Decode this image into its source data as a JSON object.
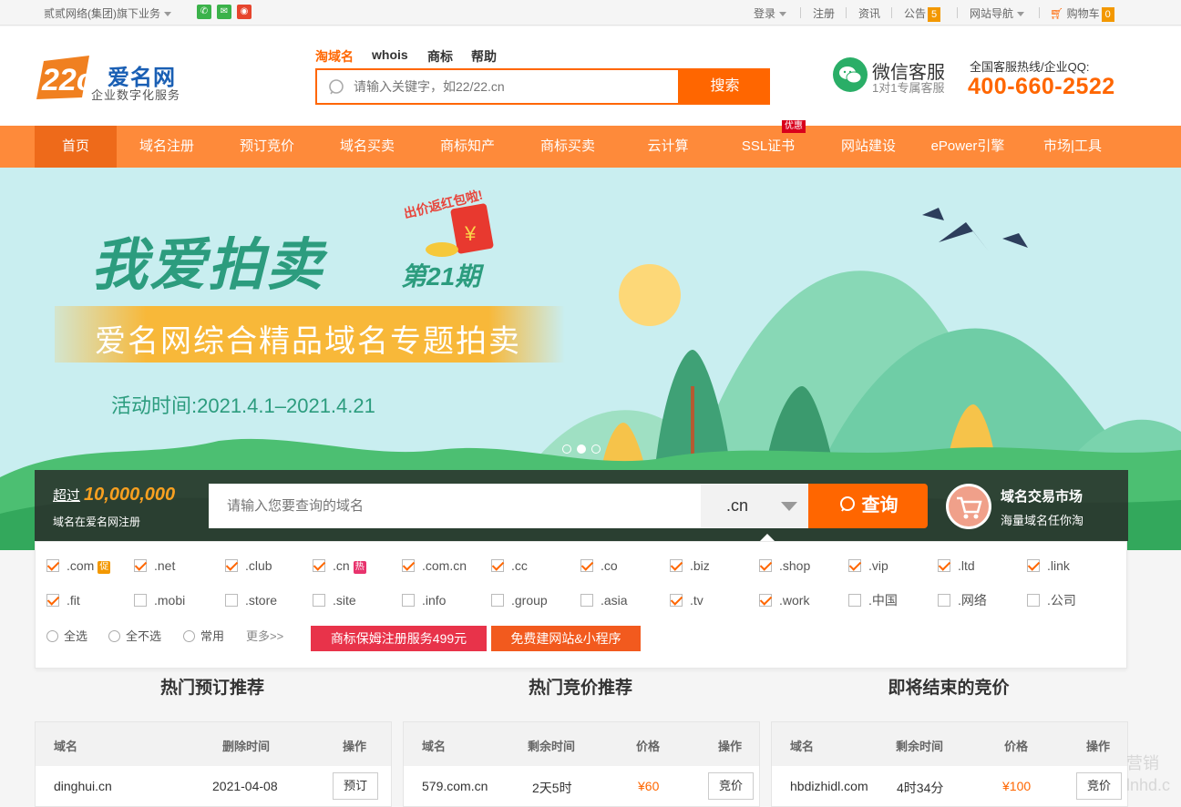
{
  "topbar": {
    "group_link": "贰贰网络(集团)旗下业务",
    "social": [
      {
        "icon": "app-icon",
        "color": "#3bb24a"
      },
      {
        "icon": "wechat-icon",
        "color": "#3bb24a"
      },
      {
        "icon": "weibo-icon",
        "color": "#e6452d"
      }
    ],
    "login": "登录",
    "register": "注册",
    "news": "资讯",
    "notice": "公告",
    "notice_count": "5",
    "site_nav": "网站导航",
    "cart": "购物车",
    "cart_count": "0"
  },
  "header": {
    "logo_mark": "22cn",
    "logo_name": "爱名网",
    "logo_slogan": "企业数字化服务",
    "search_tabs": [
      "淘域名",
      "whois",
      "商标",
      "帮助"
    ],
    "search_placeholder": "请输入关键字，如22/22.cn",
    "search_button": "搜索",
    "wechat_title": "微信客服",
    "wechat_sub": "1对1专属客服",
    "hotline_label": "全国客服热线/企业QQ:",
    "hotline": "400-660-2522"
  },
  "nav": {
    "items": [
      "首页",
      "域名注册",
      "预订竞价",
      "域名买卖",
      "商标知产",
      "商标买卖",
      "云计算",
      "SSL证书",
      "网站建设",
      "ePower引擎",
      "市场|工具"
    ],
    "active": "首页",
    "ssl_tag": "优惠"
  },
  "banner": {
    "title": "我爱拍卖",
    "issue": "第21期",
    "rebate": "出价返红包啦!",
    "subtitle": "爱名网综合精品域名专题拍卖",
    "time": "活动时间:2021.4.1–2021.4.21",
    "slides": 3,
    "active_slide": 2
  },
  "domain_search": {
    "over_label": "超过",
    "count": "10,000,000",
    "sub": "域名在爱名网注册",
    "placeholder": "请输入您要查询的域名",
    "suffix": ".cn",
    "button": "查询",
    "market_title": "域名交易市场",
    "market_sub": "海量域名任你淘"
  },
  "tlds": [
    {
      "name": ".com",
      "checked": true,
      "tag": "促",
      "tag_color": "#f39800"
    },
    {
      "name": ".net",
      "checked": true
    },
    {
      "name": ".club",
      "checked": true
    },
    {
      "name": ".cn",
      "checked": true,
      "tag": "热",
      "tag_color": "#e8336d"
    },
    {
      "name": ".com.cn",
      "checked": true
    },
    {
      "name": ".cc",
      "checked": true
    },
    {
      "name": ".co",
      "checked": true
    },
    {
      "name": ".biz",
      "checked": true
    },
    {
      "name": ".shop",
      "checked": true
    },
    {
      "name": ".vip",
      "checked": true
    },
    {
      "name": ".ltd",
      "checked": true
    },
    {
      "name": ".link",
      "checked": true
    },
    {
      "name": ".fit",
      "checked": true
    },
    {
      "name": ".mobi",
      "checked": false
    },
    {
      "name": ".store",
      "checked": false
    },
    {
      "name": ".site",
      "checked": false
    },
    {
      "name": ".info",
      "checked": false
    },
    {
      "name": ".group",
      "checked": false
    },
    {
      "name": ".asia",
      "checked": false
    },
    {
      "name": ".tv",
      "checked": true
    },
    {
      "name": ".work",
      "checked": true
    },
    {
      "name": ".中国",
      "checked": false
    },
    {
      "name": ".网络",
      "checked": false
    },
    {
      "name": ".公司",
      "checked": false
    }
  ],
  "tld_options": {
    "select_all": "全选",
    "select_none": "全不选",
    "common": "常用",
    "more": "更多>>",
    "promo1": "商标保姆注册服务499元",
    "promo1_color": "#e8334a",
    "promo2": "免费建网站&小程序",
    "promo2_color": "#f25a1e"
  },
  "sections": {
    "reserve": {
      "title": "热门预订推荐",
      "headers": [
        "域名",
        "删除时间",
        "操作"
      ],
      "row": {
        "domain": "dinghui.cn",
        "time": "2021-04-08",
        "action": "预订"
      }
    },
    "bidding": {
      "title": "热门竞价推荐",
      "headers": [
        "域名",
        "剩余时间",
        "价格",
        "操作"
      ],
      "row": {
        "domain": "579.com.cn",
        "time": "2天5时",
        "price": "¥60",
        "action": "竞价"
      }
    },
    "ending": {
      "title": "即将结束的竞价",
      "headers": [
        "域名",
        "剩余时间",
        "价格",
        "操作"
      ],
      "row": {
        "domain": "hbdizhidl.com",
        "time": "4时34分",
        "price": "¥100",
        "action": "竞价"
      }
    }
  },
  "watermark": "营销 lnhd.c",
  "colors": {
    "accent": "#ff6600",
    "nav": "#fe8a3a",
    "nav_active": "#ee6a1a",
    "brand_blue": "#1a5fb4",
    "banner_green": "#2c9c7e"
  }
}
